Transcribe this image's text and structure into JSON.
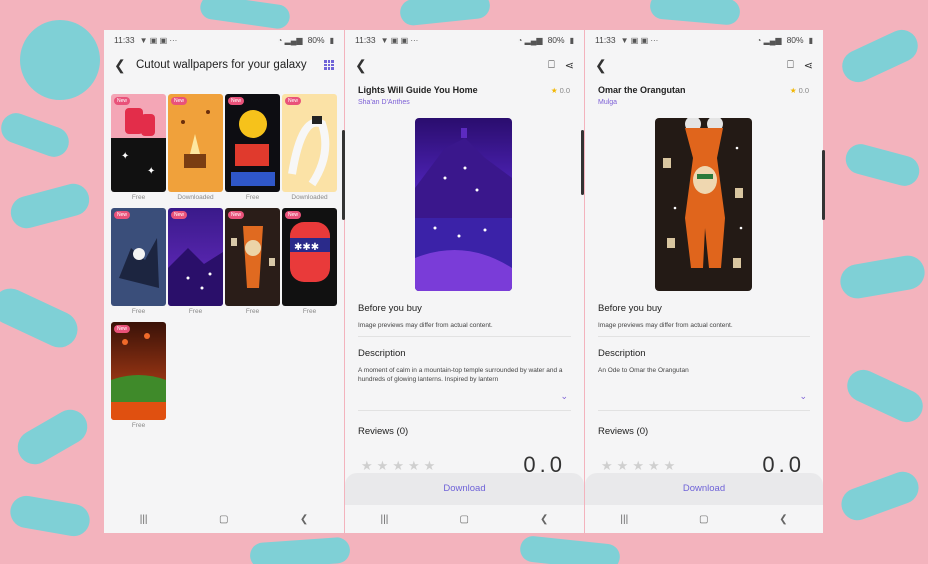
{
  "status_bar": {
    "time": "11:33",
    "battery": "80%"
  },
  "gallery": {
    "title": "Cutout wallpapers for your galaxy",
    "new_badge": "New",
    "tiles": [
      {
        "label": "Free",
        "badge": "New"
      },
      {
        "label": "Downloaded",
        "badge": "New"
      },
      {
        "label": "Free",
        "badge": "New"
      },
      {
        "label": "Downloaded",
        "badge": "New"
      },
      {
        "label": "Free",
        "badge": "New"
      },
      {
        "label": "Free",
        "badge": "New"
      },
      {
        "label": "Free",
        "badge": "New"
      },
      {
        "label": "Free",
        "badge": "New"
      },
      {
        "label": "Free",
        "badge": "New"
      }
    ]
  },
  "detail1": {
    "title": "Lights Will Guide You Home",
    "author": "Sha'an D'Anthes",
    "rating": "0.0",
    "before_buy_title": "Before you buy",
    "before_buy_text": "Image previews may differ from actual content.",
    "description_title": "Description",
    "description_text": "A moment of calm in a mountain-top temple surrounded by water and a hundreds of glowing lanterns. Inspired by lantern",
    "reviews_title": "Reviews (0)",
    "score": "0.0",
    "download": "Download"
  },
  "detail2": {
    "title": "Omar the Orangutan",
    "author": "Mulga",
    "rating": "0.0",
    "before_buy_title": "Before you buy",
    "before_buy_text": "Image previews may differ from actual content.",
    "description_title": "Description",
    "description_text": "An Ode to Omar the Orangutan",
    "reviews_title": "Reviews (0)",
    "score": "0.0",
    "download": "Download"
  },
  "icons": {
    "back": "back-arrow-icon",
    "bookmark": "bookmark-icon",
    "share": "share-icon",
    "grid": "grid-view-icon"
  },
  "colors": {
    "accent": "#6f63d8",
    "badge": "#e9527a",
    "author": "#7c5fd6",
    "star": "#f2b705"
  }
}
